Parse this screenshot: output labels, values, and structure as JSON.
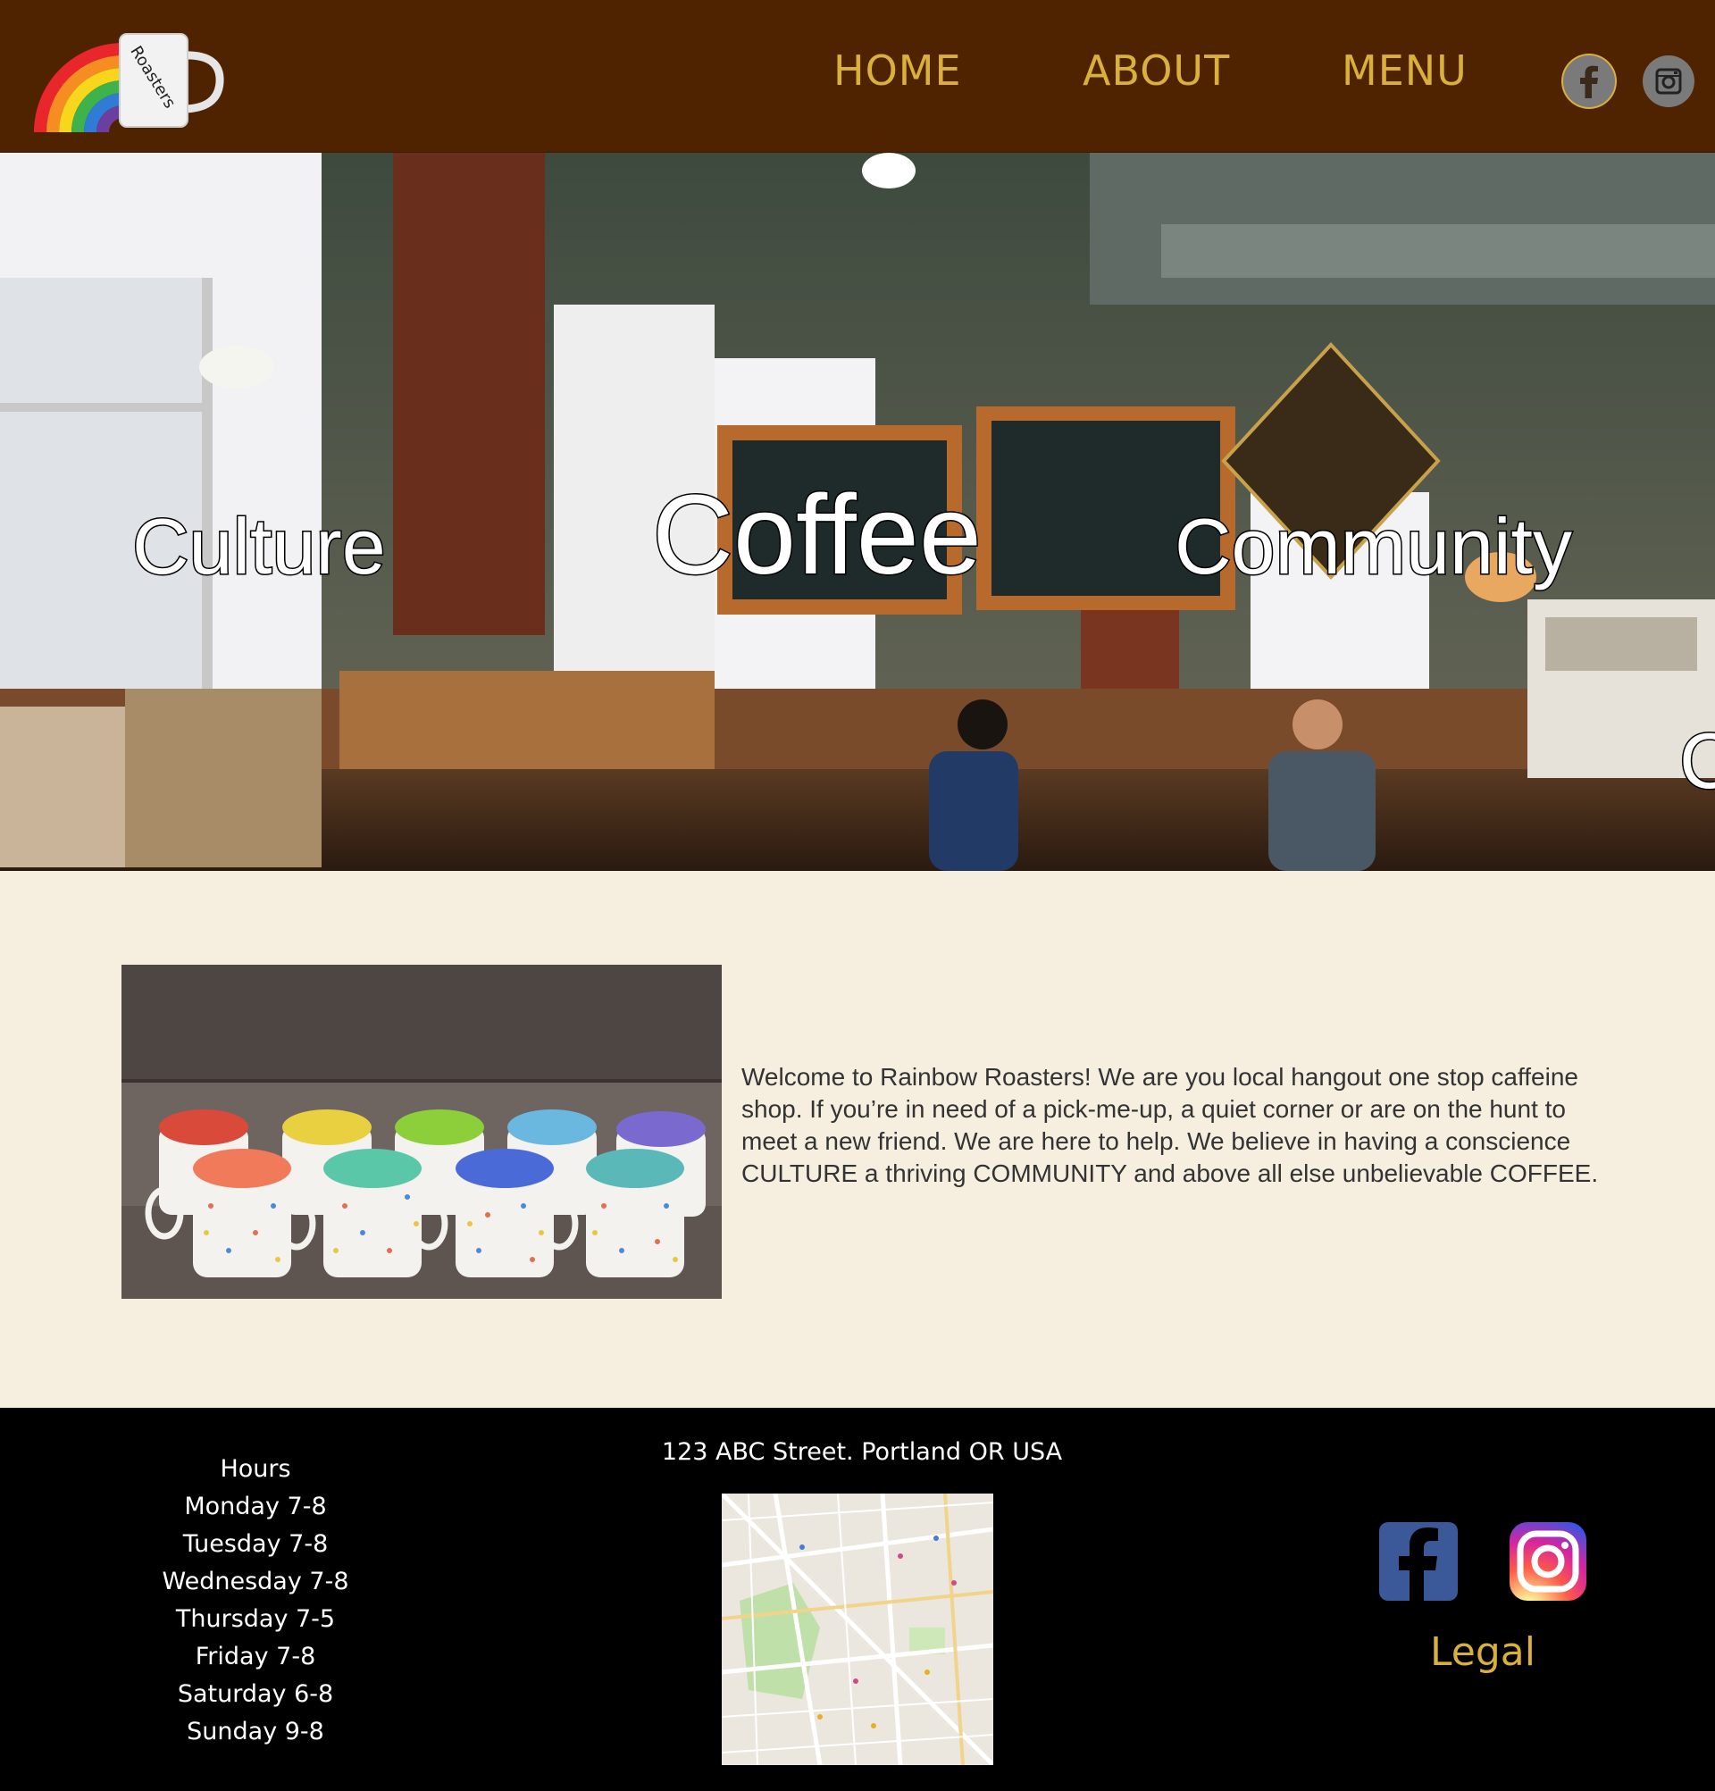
{
  "header": {
    "logo": {
      "mug_text": "Roasters",
      "rainbow_colors": [
        "#e8262b",
        "#f58d22",
        "#f8d61c",
        "#3fb34b",
        "#2f7bd6",
        "#6a3fa0"
      ]
    },
    "nav": [
      "HOME",
      "ABOUT",
      "MENU"
    ],
    "social": [
      {
        "icon": "facebook-icon"
      },
      {
        "icon": "instagram-icon"
      }
    ],
    "colors": {
      "background": "#4f2300",
      "nav_text": "#d9b13a"
    }
  },
  "hero": {
    "words": [
      "Culture",
      "Coffee",
      "Community"
    ],
    "peek": "C"
  },
  "main": {
    "background": "#f6efe0",
    "welcome_text": "Welcome to Rainbow Roasters! We are you local hangout one stop caffeine shop. If you’re in need of a pick-me-up, a quiet corner or are on the hunt to meet a new friend. We are here to help. We believe in having a conscience CULTURE a thriving COMMUNITY and above all else unbelievable COFFEE."
  },
  "footer": {
    "background": "#000000",
    "hours": [
      "Hours",
      "Monday 7-8",
      "Tuesday 7-8",
      "Wednesday 7-8",
      "Thursday 7-5",
      "Friday 7-8",
      "Saturday 6-8",
      "Sunday 9-8"
    ],
    "address": "123 ABC Street. Portland OR USA",
    "legal": "Legal",
    "colors": {
      "legal": "#d9b13a",
      "facebook": "#3b5998"
    }
  }
}
